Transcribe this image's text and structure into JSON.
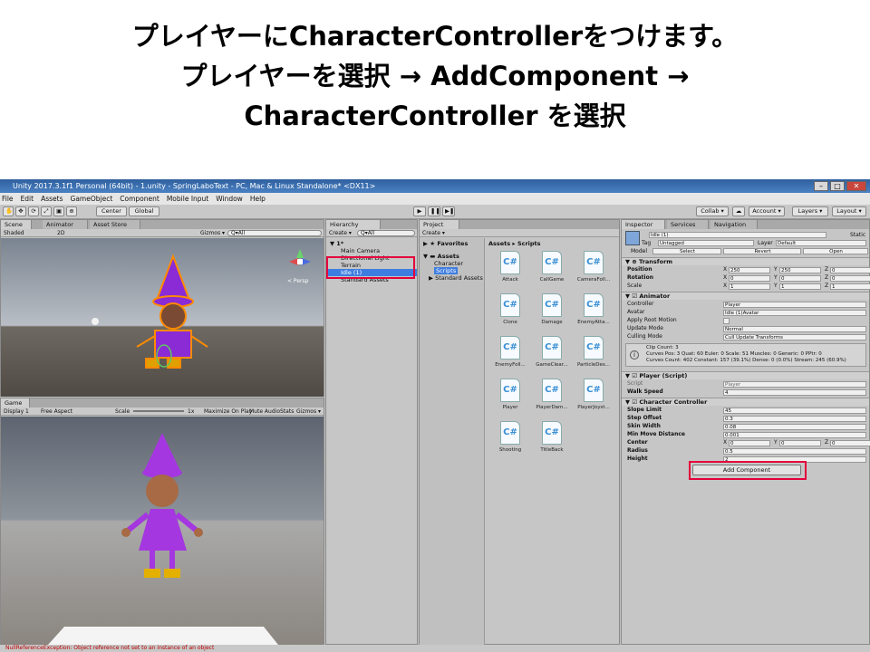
{
  "slide": {
    "title_line1": "プレイヤーにCharacterControllerをつけます。",
    "title_line2": "プレイヤーを選択 → AddComponent →",
    "title_line3": "CharacterController を選択"
  },
  "window": {
    "title": "Unity 2017.3.1f1 Personal (64bit) - 1.unity - SpringLaboText - PC, Mac & Linux Standalone* <DX11>",
    "menu": [
      "File",
      "Edit",
      "Assets",
      "GameObject",
      "Component",
      "Mobile Input",
      "Window",
      "Help"
    ]
  },
  "toolbar": {
    "center": "Center",
    "global": "Global",
    "collab": "Collab ▾",
    "account": "Account ▾",
    "layers": "Layers ▾",
    "layout": "Layout ▾"
  },
  "scene": {
    "tabs": [
      "Scene",
      "Animator",
      "Asset Store"
    ],
    "shaded": "Shaded",
    "mode2d": "2D",
    "gizmos": "Gizmos ▾",
    "search": "Q▾All",
    "persp": "< Persp"
  },
  "game": {
    "tab": "Game",
    "display": "Display 1",
    "aspect": "Free Aspect",
    "scale_label": "Scale",
    "scale_value": "1x",
    "maximize": "Maximize On Play",
    "mute": "Mute Audio",
    "stats": "Stats",
    "gizmos": "Gizmos ▾"
  },
  "hierarchy": {
    "tab": "Hierarchy",
    "create": "Create ▾",
    "search": "Q▾All",
    "scene": "1*",
    "items": [
      "Main Camera",
      "Directional Light",
      "Terrain",
      "Idle (1)",
      "Standard Assets"
    ]
  },
  "project": {
    "tab": "Project",
    "create": "Create ▾",
    "favorites": "Favorites",
    "assets": "Assets",
    "tree": [
      "Character",
      "Scripts",
      "Standard Assets"
    ],
    "breadcrumb": "Assets ▸ Scripts",
    "scripts": [
      "Attack",
      "CallGame",
      "CameraFoll...",
      "Clone",
      "Damage",
      "EnemyAtta...",
      "EnemyFoll...",
      "GameClear...",
      "ParticleDes...",
      "Player",
      "PlayerDam...",
      "PlayerJoyst...",
      "Shooting",
      "TitleBack"
    ]
  },
  "inspector": {
    "tabs": [
      "Inspector",
      "Services",
      "Navigation"
    ],
    "name": "Idle (1)",
    "static": "Static",
    "tag_label": "Tag",
    "tag": "Untagged",
    "layer_label": "Layer",
    "layer": "Default",
    "model_label": "Model",
    "model_select": "Select",
    "model_revert": "Revert",
    "model_open": "Open",
    "transform": {
      "title": "Transform",
      "position": {
        "label": "Position",
        "x": "250",
        "y": "250",
        "z": "0"
      },
      "rotation": {
        "label": "Rotation",
        "x": "0",
        "y": "0",
        "z": "0"
      },
      "scale": {
        "label": "Scale",
        "x": "1",
        "y": "1",
        "z": "1"
      }
    },
    "animator": {
      "title": "Animator",
      "controller_label": "Controller",
      "controller": "Player",
      "avatar_label": "Avatar",
      "avatar": "Idle (1)Avatar",
      "root_motion_label": "Apply Root Motion",
      "update_mode_label": "Update Mode",
      "update_mode": "Normal",
      "culling_label": "Culling Mode",
      "culling": "Cull Update Transforms",
      "info1": "Clip Count: 3",
      "info2": "Curves Pos: 3 Quat: 60 Euler: 0 Scale: 51 Muscles: 0 Generic: 0 PPtr: 0",
      "info3": "Curves Count: 402 Constant: 157 (39.1%) Dense: 0 (0.0%) Stream: 245 (60.9%)"
    },
    "player_script": {
      "title": "Player (Script)",
      "script_label": "Script",
      "script": "Player",
      "walk_label": "Walk Speed",
      "walk": "4"
    },
    "character_controller": {
      "title": "Character Controller",
      "fields": [
        {
          "label": "Slope Limit",
          "value": "45"
        },
        {
          "label": "Step Offset",
          "value": "0.3"
        },
        {
          "label": "Skin Width",
          "value": "0.08"
        },
        {
          "label": "Min Move Distance",
          "value": "0.001"
        }
      ],
      "center": {
        "label": "Center",
        "x": "0",
        "y": "0",
        "z": "0"
      },
      "radius": {
        "label": "Radius",
        "value": "0.5"
      },
      "height": {
        "label": "Height",
        "value": "2"
      }
    },
    "add_component": "Add Component"
  },
  "status": "NullReferenceException: Object reference not set to an instance of an object"
}
